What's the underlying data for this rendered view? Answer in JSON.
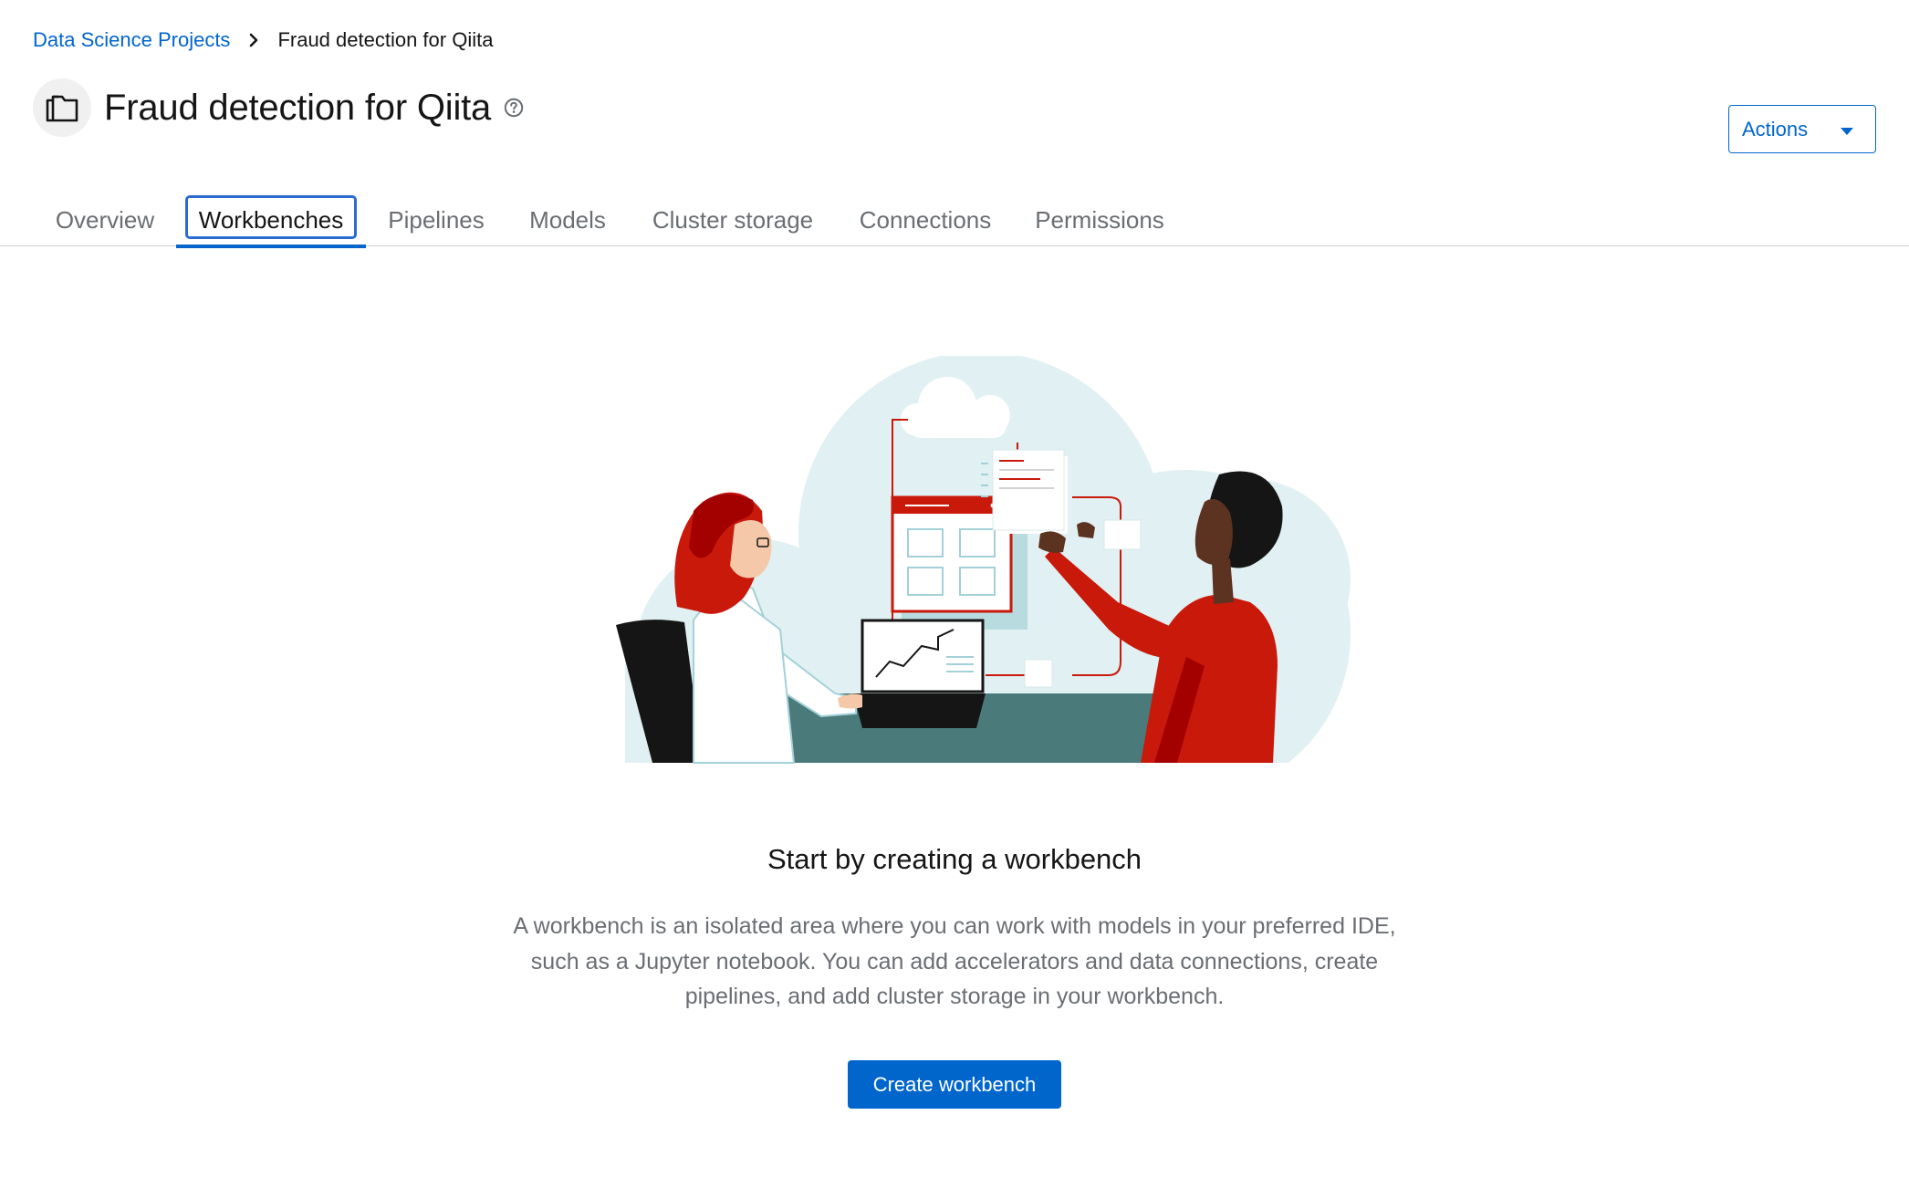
{
  "breadcrumb": {
    "parent": "Data Science Projects",
    "current": "Fraud detection for Qiita"
  },
  "header": {
    "title": "Fraud detection for Qiita",
    "actions_label": "Actions"
  },
  "tabs": [
    {
      "label": "Overview"
    },
    {
      "label": "Workbenches"
    },
    {
      "label": "Pipelines"
    },
    {
      "label": "Models"
    },
    {
      "label": "Cluster storage"
    },
    {
      "label": "Connections"
    },
    {
      "label": "Permissions"
    }
  ],
  "active_tab": "Workbenches",
  "empty_state": {
    "title": "Start by creating a workbench",
    "body": "A workbench is an isolated area where you can work with models in your preferred IDE, such as a Jupyter notebook. You can add accelerators and data connections, create pipelines, and add cluster storage in your workbench.",
    "button_label": "Create workbench"
  },
  "colors": {
    "link": "#0066cc",
    "primary_button": "#0066cc",
    "accent_red": "#c9190b",
    "illustration_bg": "#e1f0f2",
    "desk": "#4a7a7a"
  },
  "icons": {
    "breadcrumb_separator": "chevron-right-icon",
    "project": "project-folder-icon",
    "help": "help-icon",
    "dropdown": "caret-down-icon"
  }
}
